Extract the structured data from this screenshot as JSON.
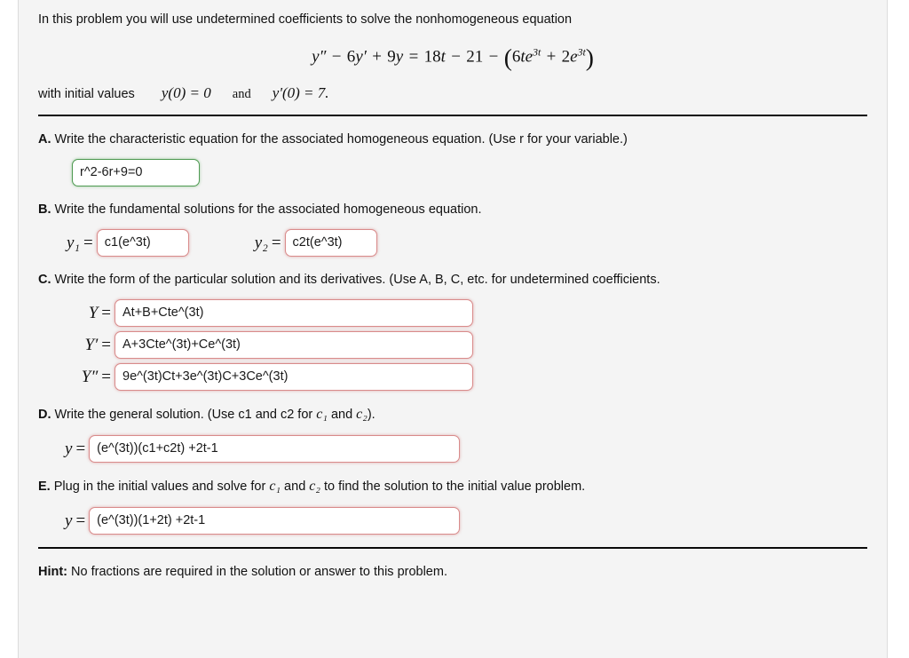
{
  "problem": {
    "intro": "In this problem you will use undetermined coefficients to solve the nonhomogeneous equation",
    "equation_plain": "y'' - 6y' + 9y = 18t - 21 - (6te^{3t} + 2e^{3t})",
    "initial_values_label": "with initial values",
    "initial_value_1": "y(0) = 0",
    "initial_conjunction": "and",
    "initial_value_2": "y'(0) = 7."
  },
  "parts": {
    "a": {
      "letter": "A.",
      "text": "Write the characteristic equation for the associated homogeneous equation. (Use r for your variable.)",
      "answer": "r^2-6r+9=0",
      "status": "correct"
    },
    "b": {
      "letter": "B.",
      "text": "Write the fundamental solutions for the associated homogeneous equation.",
      "label_1": "y₁",
      "label_2": "y₂",
      "equals": "=",
      "answer_1": "c1(e^3t)",
      "answer_2": "c2t(e^3t)",
      "status": "wrong"
    },
    "c": {
      "letter": "C.",
      "text": "Write the form of the particular solution and its derivatives. (Use A, B, C, etc. for undetermined coefficients.",
      "label_1": "Y",
      "label_2": "Y′",
      "label_3": "Y″",
      "equals": "=",
      "answer_1": "At+B+Cte^(3t)",
      "answer_2": "A+3Cte^(3t)+Ce^(3t)",
      "answer_3": "9e^(3t)Ct+3e^(3t)C+3Ce^(3t)",
      "status": "wrong"
    },
    "d": {
      "letter": "D.",
      "text_before": "Write the general solution. (Use c1 and c2 for ",
      "text_mid": " and ",
      "text_after": ").",
      "var_1": "c₁",
      "var_2": "c₂",
      "label": "y",
      "equals": "=",
      "answer": "(e^(3t))(c1+c2t) +2t-1",
      "status": "wrong"
    },
    "e": {
      "letter": "E.",
      "text_before": "Plug in the initial values and solve for ",
      "text_mid": " and ",
      "text_after": " to find the solution to the initial value problem.",
      "var_1": "c₁",
      "var_2": "c₂",
      "label": "y",
      "equals": "=",
      "answer": "(e^(3t))(1+2t) +2t-1",
      "status": "wrong"
    }
  },
  "hint": {
    "label": "Hint:",
    "text": " No fractions are required in the solution or answer to this problem."
  },
  "colors": {
    "page_background": "#f4f4f4",
    "correct_border": "#4f9a52",
    "incorrect_border": "#d98b8b",
    "rule": "#0a0a0a",
    "text": "#111111"
  }
}
